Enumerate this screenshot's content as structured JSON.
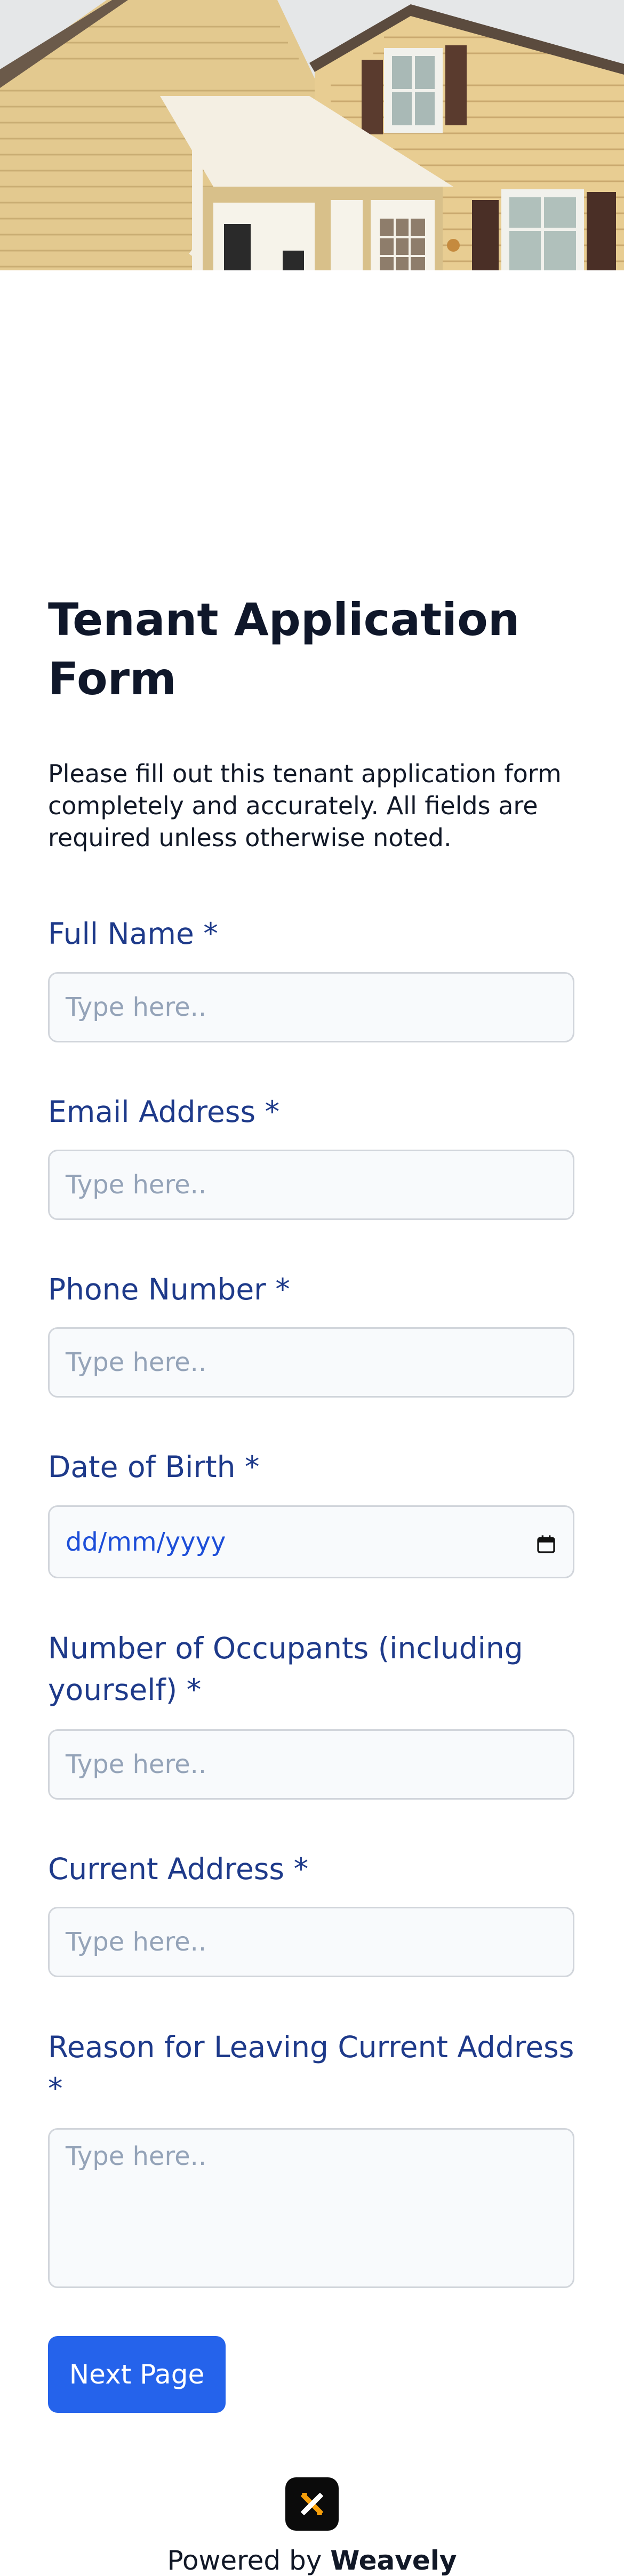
{
  "form": {
    "title": "Tenant Application Form",
    "description": "Please fill out this tenant application form completely and accurately. All fields are required unless otherwise noted.",
    "fields": [
      {
        "label": "Full Name *",
        "placeholder": "Type here.."
      },
      {
        "label": "Email Address *",
        "placeholder": "Type here.."
      },
      {
        "label": "Phone Number *",
        "placeholder": "Type here.."
      },
      {
        "label": "Date of Birth *",
        "placeholder": "dd/mm/yyyy"
      },
      {
        "label": "Number of Occupants (including yourself) *",
        "placeholder": "Type here.."
      },
      {
        "label": "Current Address *",
        "placeholder": "Type here.."
      },
      {
        "label": "Reason for Leaving Current Address *",
        "placeholder": "Type here.."
      }
    ],
    "next_button": "Next Page"
  },
  "footer": {
    "powered_by": "Powered by",
    "brand": "Weavely"
  },
  "icons": {
    "calendar": "calendar-icon",
    "logo": "weavely-logo-icon"
  },
  "colors": {
    "primary": "#2563eb",
    "label": "#1e3a8a",
    "title": "#0f172a",
    "input_bg": "#f8fafc",
    "input_border": "#d1d5db",
    "placeholder": "#94a3b8"
  }
}
